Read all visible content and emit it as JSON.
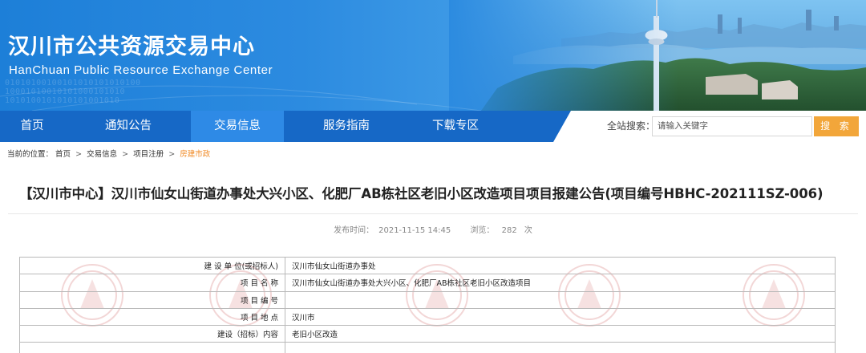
{
  "header": {
    "title": "汉川市公共资源交易中心",
    "subtitle": "HanChuan Public Resource Exchange Center"
  },
  "nav": {
    "items": [
      {
        "label": "首页",
        "active": false
      },
      {
        "label": "通知公告",
        "active": false
      },
      {
        "label": "交易信息",
        "active": true
      },
      {
        "label": "服务指南",
        "active": false
      },
      {
        "label": "下载专区",
        "active": false
      }
    ],
    "search_label": "全站搜索：",
    "search_placeholder": "请输入关键字",
    "search_button": "搜 索"
  },
  "breadcrumb": {
    "prefix": "当前的位置：",
    "items": [
      "首页",
      "交易信息",
      "项目注册"
    ],
    "current": "房建市政"
  },
  "article": {
    "title": "【汉川市中心】汉川市仙女山街道办事处大兴小区、化肥厂AB栋社区老旧小区改造项目项目报建公告(项目编号HBHC-202111SZ-006)",
    "publish_label": "发布时间：",
    "publish_time": "2021-11-15 14:45",
    "views_label": "浏览：",
    "views": "282",
    "views_unit": "次"
  },
  "table": {
    "rows": [
      {
        "key": "建 设 单 位(或招标人)",
        "value": "汉川市仙女山街道办事处"
      },
      {
        "key": "项 目 名 称",
        "value": "汉川市仙女山街道办事处大兴小区、化肥厂AB栋社区老旧小区改造项目"
      },
      {
        "key": "项 目 编 号",
        "value": ""
      },
      {
        "key": "项 目 地 点",
        "value": "汉川市"
      },
      {
        "key": "建设（招标）内容",
        "value": "老旧小区改造"
      },
      {
        "key": "",
        "value": ""
      }
    ]
  },
  "colors": {
    "nav_bg": "#1668c6",
    "nav_active": "#2e8ae6",
    "search_button": "#f2a63a",
    "breadcrumb_current": "#f08a24"
  }
}
